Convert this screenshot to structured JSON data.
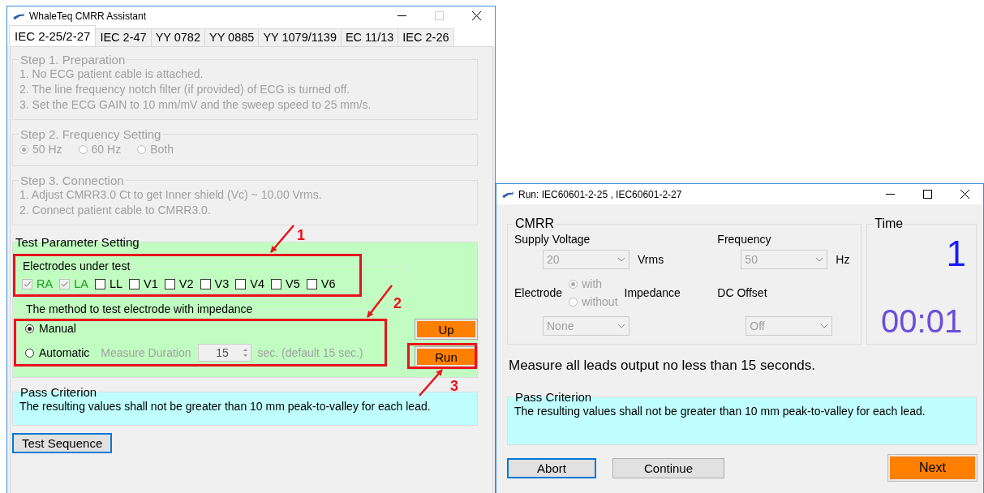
{
  "main_window": {
    "title": "WhaleTeq CMRR Assistant",
    "tabs": [
      {
        "label": "IEC 2-25/2-27",
        "selected": true
      },
      {
        "label": "IEC 2-47",
        "selected": false
      },
      {
        "label": "YY 0782",
        "selected": false
      },
      {
        "label": "YY 0885",
        "selected": false
      },
      {
        "label": "YY 1079/1139",
        "selected": false
      },
      {
        "label": "EC 11/13",
        "selected": false
      },
      {
        "label": "IEC 2-26",
        "selected": false
      }
    ],
    "step1": {
      "title": "Step 1. Preparation",
      "disabled": true,
      "lines": [
        "1. No ECG patient cable is attached.",
        "2. The line frequency notch filter (if provided) of ECG is turned off.",
        "3. Set the ECG GAIN to 10 mm/mV and the sweep speed to 25 mm/s."
      ]
    },
    "step2": {
      "title": "Step 2. Frequency Setting",
      "disabled": true,
      "options": [
        {
          "label": "50 Hz",
          "selected": true
        },
        {
          "label": "60 Hz",
          "selected": false
        },
        {
          "label": "Both",
          "selected": false
        }
      ]
    },
    "step3": {
      "title": "Step 3. Connection",
      "disabled": true,
      "lines": [
        "1. Adjust CMRR3.0 Ct to get Inner shield (Vc) ~ 10.00 Vrms.",
        "2. Connect patient cable to CMRR3.0."
      ]
    },
    "test_parameter": {
      "title": "Test Parameter Setting",
      "electrodes": {
        "title": "Electrodes under test",
        "items": [
          {
            "label": "RA",
            "checked": true,
            "disabled": true
          },
          {
            "label": "LA",
            "checked": true,
            "disabled": true
          },
          {
            "label": "LL",
            "checked": false,
            "disabled": false
          },
          {
            "label": "V1",
            "checked": false,
            "disabled": false
          },
          {
            "label": "V2",
            "checked": false,
            "disabled": false
          },
          {
            "label": "V3",
            "checked": false,
            "disabled": false
          },
          {
            "label": "V4",
            "checked": false,
            "disabled": false
          },
          {
            "label": "V5",
            "checked": false,
            "disabled": false
          },
          {
            "label": "V6",
            "checked": false,
            "disabled": false
          }
        ]
      },
      "method": {
        "title": "The method to test electrode with impedance",
        "options": [
          {
            "label": "Manual",
            "selected": true
          },
          {
            "label": "Automatic",
            "selected": false
          }
        ],
        "duration_label": "Measure Duration",
        "duration_value": "15",
        "duration_hint": "sec. (default 15 sec.)"
      },
      "buttons": [
        "Up",
        "Run"
      ]
    },
    "pass_criterion": {
      "title": "Pass Criterion",
      "text": "The resulting values shall not be greater than 10 mm peak-to-valley for each lead."
    },
    "test_sequence_button": "Test Sequence"
  },
  "annotations": [
    {
      "label": "1"
    },
    {
      "label": "2"
    },
    {
      "label": "3"
    }
  ],
  "run_window": {
    "title": "Run: IEC60601-2-25 , IEC60601-2-27",
    "cmrr": {
      "title": "CMRR",
      "supply_voltage": {
        "label": "Supply Voltage",
        "value": "20",
        "unit": "Vrms",
        "disabled": true
      },
      "frequency": {
        "label": "Frequency",
        "value": "50",
        "unit": "Hz",
        "disabled": true
      },
      "electrode": {
        "label": "Electrode",
        "options": [
          {
            "label": "with",
            "selected": true
          },
          {
            "label": "without",
            "selected": false
          }
        ],
        "suffix": "Impedance",
        "value": "None",
        "disabled": true
      },
      "dc_offset": {
        "label": "DC Offset",
        "value": "Off",
        "disabled": true
      }
    },
    "time": {
      "title": "Time",
      "count": "1",
      "clock": "00:01"
    },
    "message": "Measure all leads output no less than 15 seconds.",
    "pass_criterion": {
      "title": "Pass Criterion",
      "text": "The resulting values shall not be greater than 10 mm peak-to-valley for each lead."
    },
    "buttons": [
      {
        "label": "Abort",
        "kind": "focused"
      },
      {
        "label": "Continue",
        "kind": "plain"
      },
      {
        "label": "Next",
        "kind": "primary"
      }
    ]
  }
}
